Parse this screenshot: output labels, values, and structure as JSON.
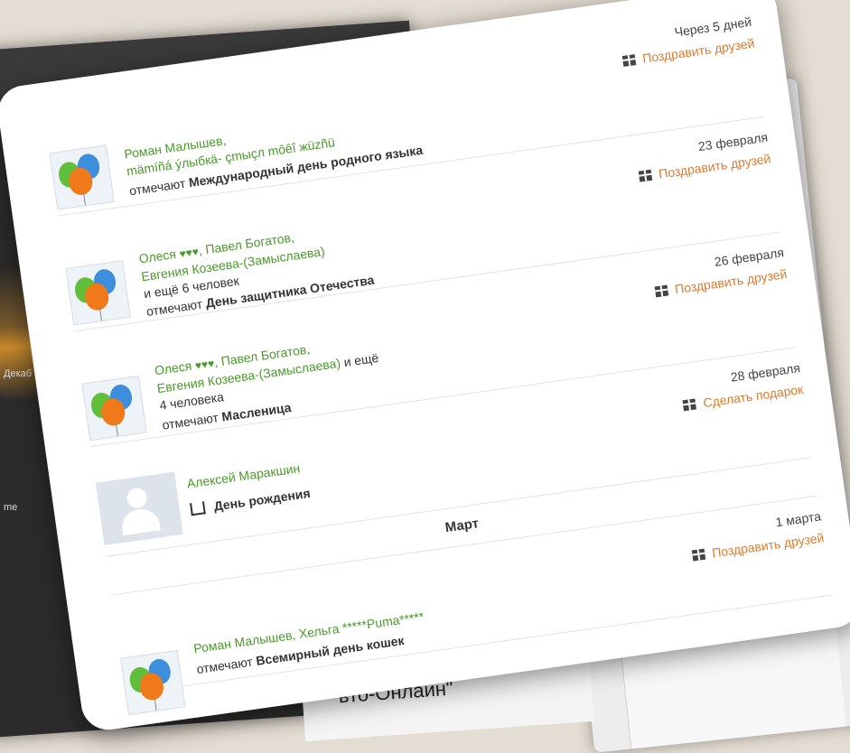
{
  "background": {
    "left_label": "Декаб",
    "left_label2": "me",
    "bottom_text": "вто-Онлайн\""
  },
  "events": [
    {
      "date": "Через 5 дней",
      "action": "Поздравить друзей",
      "names": "Роман Малышев,",
      "names2": "mämíñá ýлыбкä- çmыçл môêî жüzñü",
      "verb": "отмечают",
      "holiday": "Международный день родного языка"
    },
    {
      "date": "23 февраля",
      "action": "Поздравить друзей",
      "name_a": "Олеся",
      "hearts": "♥♥♥",
      "name_b": ", Павел Богатов,",
      "name_c": "Евгения Козеева-(Замыслаева)",
      "more": "и ещё 6 человек",
      "verb": "отмечают",
      "holiday": "День защитника Отечества"
    },
    {
      "date": "26 февраля",
      "action": "Поздравить друзей",
      "name_a": "Олеся",
      "hearts": "♥♥♥",
      "name_b": ", Павел Богатов,",
      "name_c": "Евгения Козеева-(Замыслаева)",
      "more_a": " и ещё",
      "more_b": "4 человека",
      "verb": "отмечают",
      "holiday": "Масленица"
    },
    {
      "date": "28 февраля",
      "action": "Сделать подарок",
      "name": "Алексей Маракшин",
      "holiday": "День рождения"
    }
  ],
  "month_header": "Март",
  "last_event": {
    "date": "1 марта",
    "action": "Поздравить друзей",
    "names": "Роман Малышев, Хельга *****Puma*****",
    "verb": "отмечают",
    "holiday": "Всемирный день кошек"
  },
  "icons": [
    "gift-icon",
    "cake-icon",
    "balloons-icon",
    "default-avatar-icon"
  ]
}
